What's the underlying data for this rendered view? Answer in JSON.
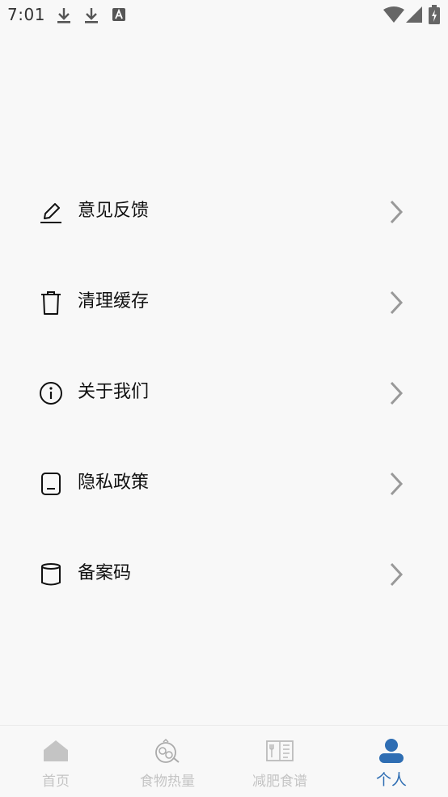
{
  "status_bar": {
    "time": "7:01",
    "icons": [
      "download-icon",
      "download-icon",
      "a-badge-icon",
      "wifi-icon",
      "signal-icon",
      "battery-charging-icon"
    ]
  },
  "menu": {
    "items": [
      {
        "label": "意见反馈",
        "icon": "edit-pen-icon"
      },
      {
        "label": "清理缓存",
        "icon": "trash-icon"
      },
      {
        "label": "关于我们",
        "icon": "info-icon"
      },
      {
        "label": "隐私政策",
        "icon": "document-icon"
      },
      {
        "label": "备案码",
        "icon": "cylinder-icon"
      }
    ]
  },
  "tabbar": {
    "tabs": [
      {
        "label": "首页",
        "icon": "home-icon"
      },
      {
        "label": "食物热量",
        "icon": "food-icon"
      },
      {
        "label": "减肥食谱",
        "icon": "recipe-book-icon"
      },
      {
        "label": "个人",
        "icon": "person-icon"
      }
    ],
    "active_index": 3,
    "active_color": "#2f6eb3",
    "inactive_color": "#c4c4c4"
  }
}
